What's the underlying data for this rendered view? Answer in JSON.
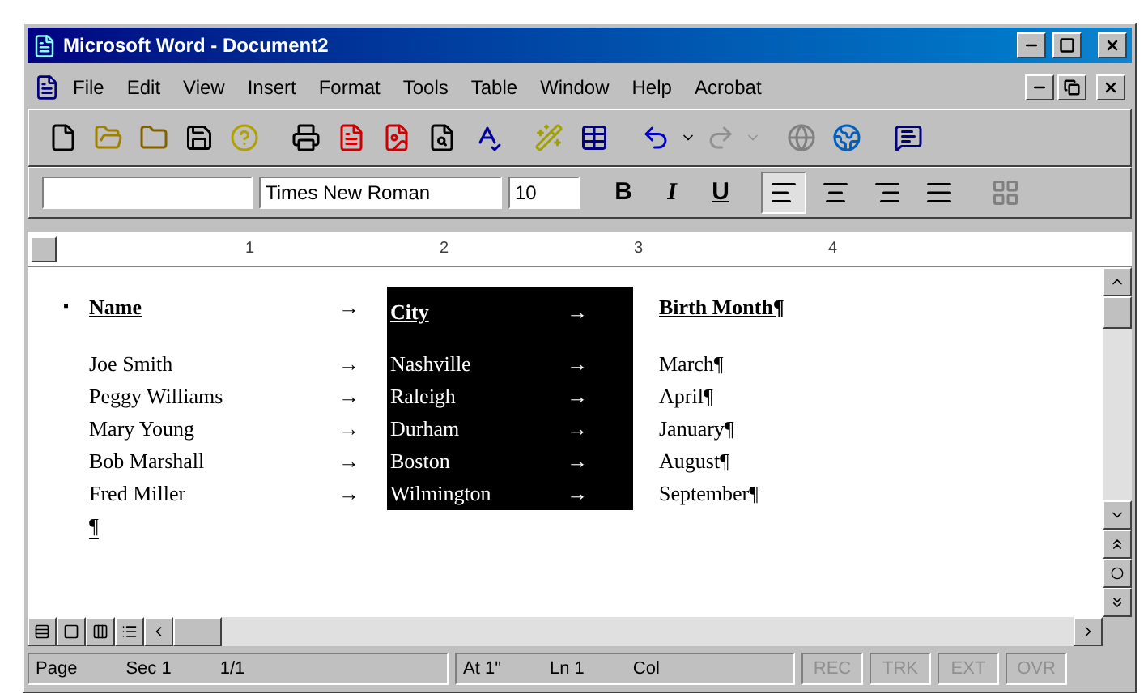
{
  "window": {
    "title": "Microsoft Word - Document2"
  },
  "menu": [
    "File",
    "Edit",
    "View",
    "Insert",
    "Format",
    "Tools",
    "Table",
    "Window",
    "Help",
    "Acrobat"
  ],
  "formatting": {
    "font": "Times New Roman",
    "size": "10",
    "bold": "B",
    "italic": "I",
    "underline": "U",
    "alignments": [
      {
        "kind": "left",
        "selected": true
      },
      {
        "kind": "center",
        "selected": false
      },
      {
        "kind": "right",
        "selected": false
      },
      {
        "kind": "justify",
        "selected": false
      }
    ]
  },
  "ruler": [
    "1",
    "2",
    "3",
    "4"
  ],
  "document": {
    "city_column": {
      "selected": true
    },
    "header": {
      "marker": "▪",
      "name": "Name",
      "name_tab": "→",
      "city": "City",
      "city_tab": "→",
      "month": "Birth Month¶"
    },
    "rows": [
      {
        "name": "Joe Smith",
        "name_tab": "→",
        "city": "Nashville",
        "city_tab": "→",
        "month": "March¶"
      },
      {
        "name": "Peggy Williams",
        "name_tab": "→",
        "city": "Raleigh",
        "city_tab": "→",
        "month": "April¶"
      },
      {
        "name": "Mary Young",
        "name_tab": "→",
        "city": "Durham",
        "city_tab": "→",
        "month": "January¶"
      },
      {
        "name": "Bob Marshall",
        "name_tab": "→",
        "city": "Boston",
        "city_tab": "→",
        "month": "August¶"
      },
      {
        "name": "Fred Miller",
        "name_tab": "→",
        "city": "Wilmington",
        "city_tab": "→",
        "month": "September¶"
      }
    ],
    "end_mark": "¶"
  },
  "status_bar": {
    "groups": [
      [
        "Page",
        "Sec 1",
        "1/1"
      ],
      [
        "At 1\"",
        "Ln 1",
        "Col"
      ]
    ],
    "indicators": [
      {
        "label": "REC",
        "active": false
      },
      {
        "label": "TRK",
        "active": false
      },
      {
        "label": "EXT",
        "active": false
      },
      {
        "label": "OVR",
        "active": false
      }
    ]
  }
}
